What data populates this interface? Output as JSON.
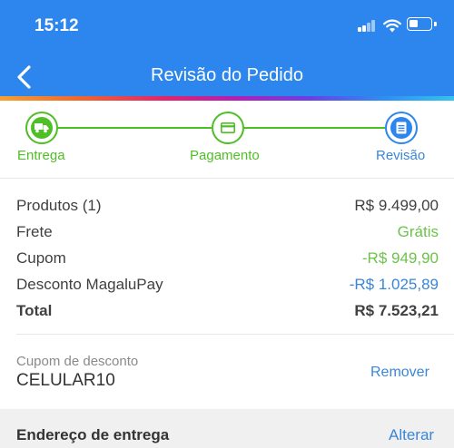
{
  "status_bar": {
    "time": "15:12"
  },
  "header": {
    "title": "Revisão do Pedido",
    "back_icon": "chevron-left-icon"
  },
  "steps": [
    {
      "label": "Entrega",
      "icon": "truck-icon",
      "color": "#4fbf26"
    },
    {
      "label": "Pagamento",
      "icon": "credit-card-icon",
      "color": "#4fbf26"
    },
    {
      "label": "Revisão",
      "icon": "document-icon",
      "color": "#2d86ee"
    }
  ],
  "summary": {
    "rows": [
      {
        "label": "Produtos (1)",
        "value": "R$ 9.499,00"
      },
      {
        "label": "Frete",
        "value": "Grátis"
      },
      {
        "label": "Cupom",
        "value": "-R$ 949,90"
      },
      {
        "label": "Desconto MagaluPay",
        "value": "-R$ 1.025,89"
      },
      {
        "label": "Total",
        "value": "R$ 7.523,21"
      }
    ]
  },
  "coupon": {
    "label": "Cupom de desconto",
    "code": "CELULAR10",
    "remove_label": "Remover"
  },
  "address": {
    "title": "Endereço de entrega",
    "alter_label": "Alterar"
  },
  "colors": {
    "header": "#2d86ee",
    "green": "#4fbf26",
    "link_blue": "#3a86d8"
  }
}
